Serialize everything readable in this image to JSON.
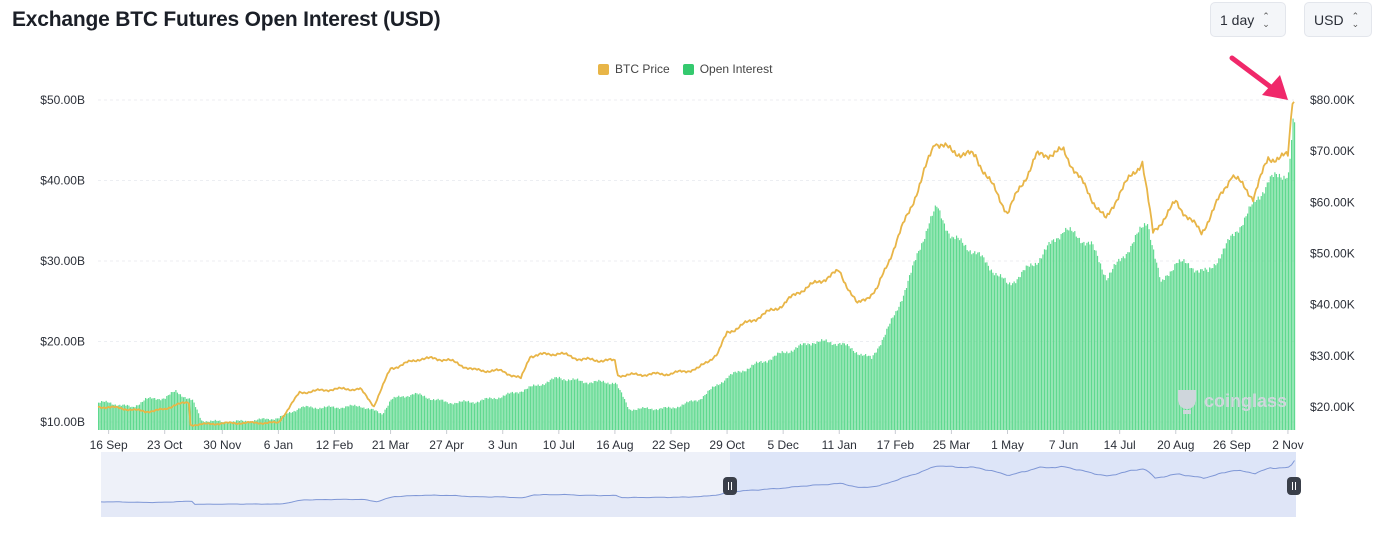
{
  "header": {
    "title": "Exchange BTC Futures Open Interest (USD)",
    "interval_select": "1 day",
    "currency_select": "USD"
  },
  "watermark": "coinglass",
  "colors": {
    "price": "#e8b547",
    "open_interest": "#34c96e",
    "arrow": "#f0286a",
    "navigator_line": "#7f97d6",
    "navigator_fill": "#dde5f8"
  },
  "chart_data": {
    "type": "bar",
    "title": "Exchange BTC Futures Open Interest (USD)",
    "legend": {
      "position": "top-center",
      "entries": [
        "BTC Price",
        "Open Interest"
      ]
    },
    "grid": true,
    "x_ticks": [
      "16 Sep",
      "23 Oct",
      "30 Nov",
      "6 Jan",
      "12 Feb",
      "21 Mar",
      "27 Apr",
      "3 Jun",
      "10 Jul",
      "16 Aug",
      "22 Sep",
      "29 Oct",
      "5 Dec",
      "11 Jan",
      "17 Feb",
      "25 Mar",
      "1 May",
      "7 Jun",
      "14 Jul",
      "20 Aug",
      "26 Sep",
      "2 Nov"
    ],
    "y_left": {
      "ticks": [
        "$10.00B",
        "$20.00B",
        "$30.00B",
        "$40.00B",
        "$50.00B"
      ],
      "range": [
        9,
        50
      ]
    },
    "y_right": {
      "ticks": [
        "$20.00K",
        "$30.00K",
        "$40.00K",
        "$50.00K",
        "$60.00K",
        "$70.00K",
        "$80.00K"
      ],
      "range": [
        15500,
        80000
      ]
    },
    "series": [
      {
        "name": "Open Interest",
        "type": "bar",
        "axis": "left",
        "unit": "USD billions",
        "points": [
          [
            "16 Sep",
            12.4
          ],
          [
            "1 Oct",
            11.8
          ],
          [
            "10 Oct",
            12.8
          ],
          [
            "23 Oct",
            13.0
          ],
          [
            "30 Oct",
            13.8
          ],
          [
            "10 Nov",
            12.6
          ],
          [
            "16 Nov",
            10.2
          ],
          [
            "30 Nov",
            10.0
          ],
          [
            "15 Dec",
            10.1
          ],
          [
            "6 Jan",
            10.5
          ],
          [
            "20 Jan",
            11.8
          ],
          [
            "12 Feb",
            11.8
          ],
          [
            "1 Mar",
            12.0
          ],
          [
            "15 Mar",
            11.0
          ],
          [
            "21 Mar",
            12.8
          ],
          [
            "5 Apr",
            13.5
          ],
          [
            "27 Apr",
            12.4
          ],
          [
            "15 May",
            12.5
          ],
          [
            "3 Jun",
            13.2
          ],
          [
            "20 Jun",
            14.2
          ],
          [
            "10 Jul",
            15.5
          ],
          [
            "25 Jul",
            15.0
          ],
          [
            "16 Aug",
            14.9
          ],
          [
            "25 Aug",
            11.6
          ],
          [
            "22 Sep",
            11.7
          ],
          [
            "10 Oct",
            12.8
          ],
          [
            "29 Oct",
            15.6
          ],
          [
            "15 Nov",
            17.0
          ],
          [
            "5 Dec",
            18.6
          ],
          [
            "25 Dec",
            20.0
          ],
          [
            "11 Jan",
            19.8
          ],
          [
            "1 Feb",
            17.8
          ],
          [
            "17 Feb",
            23.5
          ],
          [
            "1 Mar",
            30.0
          ],
          [
            "10 Mar",
            35.0
          ],
          [
            "15 Mar",
            36.5
          ],
          [
            "25 Mar",
            33.0
          ],
          [
            "10 Apr",
            31.0
          ],
          [
            "1 May",
            27.0
          ],
          [
            "20 May",
            30.0
          ],
          [
            "7 Jun",
            34.0
          ],
          [
            "25 Jun",
            32.0
          ],
          [
            "5 Jul",
            28.0
          ],
          [
            "14 Jul",
            30.0
          ],
          [
            "1 Aug",
            35.0
          ],
          [
            "10 Aug",
            27.0
          ],
          [
            "20 Aug",
            30.0
          ],
          [
            "10 Sep",
            28.5
          ],
          [
            "26 Sep",
            33.0
          ],
          [
            "10 Oct",
            37.0
          ],
          [
            "20 Oct",
            40.0
          ],
          [
            "2 Nov",
            41.0
          ],
          [
            "5 Nov",
            47.0
          ]
        ]
      },
      {
        "name": "BTC Price",
        "type": "line",
        "axis": "right",
        "unit": "USD",
        "points": [
          [
            "16 Sep",
            20000
          ],
          [
            "1 Oct",
            19500
          ],
          [
            "10 Oct",
            19100
          ],
          [
            "23 Oct",
            19500
          ],
          [
            "30 Oct",
            20500
          ],
          [
            "8 Nov",
            20800
          ],
          [
            "9 Nov",
            16500
          ],
          [
            "30 Nov",
            16800
          ],
          [
            "15 Dec",
            16900
          ],
          [
            "6 Jan",
            16900
          ],
          [
            "20 Jan",
            22800
          ],
          [
            "12 Feb",
            23500
          ],
          [
            "1 Mar",
            23500
          ],
          [
            "10 Mar",
            20200
          ],
          [
            "21 Mar",
            27500
          ],
          [
            "10 Apr",
            29500
          ],
          [
            "27 Apr",
            29300
          ],
          [
            "15 May",
            27200
          ],
          [
            "3 Jun",
            27000
          ],
          [
            "15 Jun",
            25500
          ],
          [
            "21 Jun",
            30000
          ],
          [
            "10 Jul",
            30500
          ],
          [
            "25 Jul",
            29300
          ],
          [
            "16 Aug",
            29000
          ],
          [
            "18 Aug",
            26200
          ],
          [
            "22 Sep",
            26500
          ],
          [
            "10 Oct",
            27500
          ],
          [
            "23 Oct",
            30500
          ],
          [
            "29 Oct",
            34500
          ],
          [
            "15 Nov",
            37000
          ],
          [
            "5 Dec",
            40000
          ],
          [
            "15 Dec",
            42500
          ],
          [
            "11 Jan",
            46500
          ],
          [
            "23 Jan",
            40000
          ],
          [
            "5 Feb",
            43000
          ],
          [
            "17 Feb",
            51800
          ],
          [
            "5 Mar",
            64000
          ],
          [
            "14 Mar",
            72000
          ],
          [
            "25 Mar",
            70000
          ],
          [
            "10 Apr",
            69000
          ],
          [
            "1 May",
            58000
          ],
          [
            "20 May",
            69000
          ],
          [
            "7 Jun",
            70000
          ],
          [
            "25 Jun",
            61000
          ],
          [
            "5 Jul",
            56500
          ],
          [
            "14 Jul",
            62000
          ],
          [
            "29 Jul",
            68000
          ],
          [
            "5 Aug",
            54000
          ],
          [
            "20 Aug",
            60000
          ],
          [
            "6 Sep",
            54000
          ],
          [
            "26 Sep",
            65500
          ],
          [
            "10 Oct",
            61000
          ],
          [
            "20 Oct",
            68500
          ],
          [
            "2 Nov",
            69000
          ],
          [
            "5 Nov",
            80000
          ]
        ]
      }
    ]
  }
}
